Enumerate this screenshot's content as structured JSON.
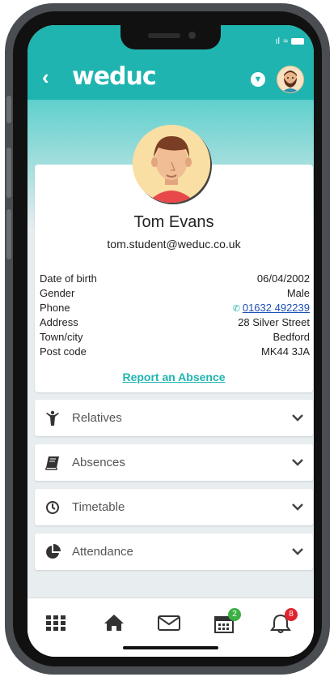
{
  "app": {
    "logo": "weduc"
  },
  "status": {
    "signal": "ıl",
    "wifi": "≈"
  },
  "header": {
    "back_icon": "back-chevron-icon",
    "dropdown_icon": "chevron-down-circle-icon"
  },
  "profile": {
    "name": "Tom Evans",
    "email": "tom.student@weduc.co.uk",
    "details": [
      {
        "label": "Date of birth",
        "value": "06/04/2002"
      },
      {
        "label": "Gender",
        "value": "Male"
      },
      {
        "label": "Phone",
        "value": "01632 492239"
      },
      {
        "label": "Address",
        "value": "28 Silver Street"
      },
      {
        "label": "Town/city",
        "value": "Bedford"
      },
      {
        "label": "Post code",
        "value": "MK44 3JA"
      }
    ],
    "report_absence": "Report an Absence"
  },
  "sections": [
    {
      "label": "Relatives",
      "icon": "person-arms-up-icon"
    },
    {
      "label": "Absences",
      "icon": "book-icon"
    },
    {
      "label": "Timetable",
      "icon": "clock-icon"
    },
    {
      "label": "Attendance",
      "icon": "pie-chart-icon"
    }
  ],
  "bottom_nav": {
    "calendar_badge": "2",
    "notifications_badge": "8",
    "badge_colors": {
      "calendar": "#3cb043",
      "notifications": "#e0242e"
    }
  },
  "colors": {
    "brand": "#1fb4b0",
    "link": "#1a4fb5"
  }
}
